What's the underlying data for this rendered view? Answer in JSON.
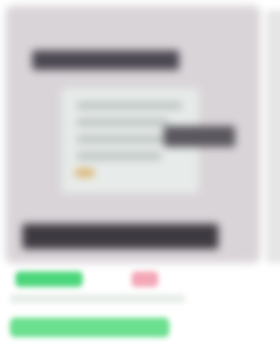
{
  "preview": {
    "colors": {
      "card_background": "#d9d4d8",
      "dark_bar": "#4c4852",
      "panel": "#e7ebe9",
      "accent": "#d9a95a"
    }
  },
  "meta": {
    "colors": {
      "tag_green": "#4cd67b",
      "tag_pink": "#f4a6b7",
      "action_button": "#6be08f"
    }
  }
}
